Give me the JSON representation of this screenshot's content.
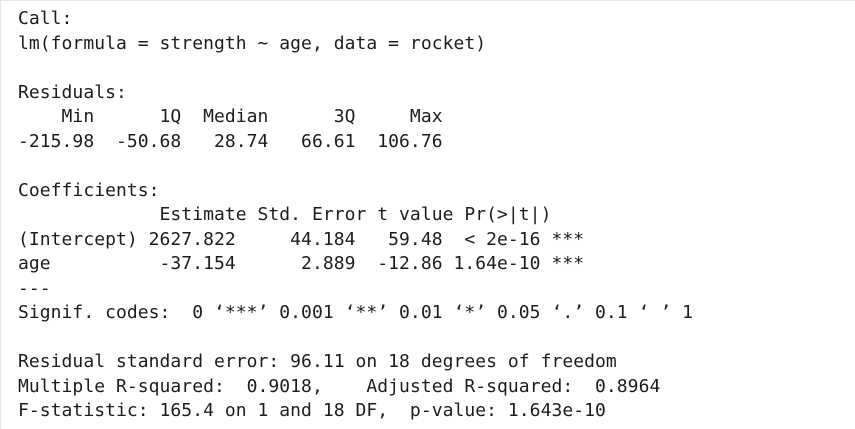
{
  "console": {
    "lines": [
      "Call:",
      "lm(formula = strength ~ age, data = rocket)",
      "",
      "Residuals:",
      "    Min      1Q  Median      3Q     Max ",
      "-215.98  -50.68   28.74   66.61  106.76 ",
      "",
      "Coefficients:",
      "             Estimate Std. Error t value Pr(>|t|)    ",
      "(Intercept) 2627.822     44.184   59.48  < 2e-16 ***",
      "age          -37.154      2.889  -12.86 1.64e-10 ***",
      "---",
      "Signif. codes:  0 ‘***’ 0.001 ‘**’ 0.01 ‘*’ 0.05 ‘.’ 0.1 ‘ ’ 1",
      "",
      "Residual standard error: 96.11 on 18 degrees of freedom",
      "Multiple R-squared:  0.9018,\tAdjusted R-squared:  0.8964 ",
      "F-statistic: 165.4 on 1 and 18 DF,  p-value: 1.643e-10"
    ]
  }
}
